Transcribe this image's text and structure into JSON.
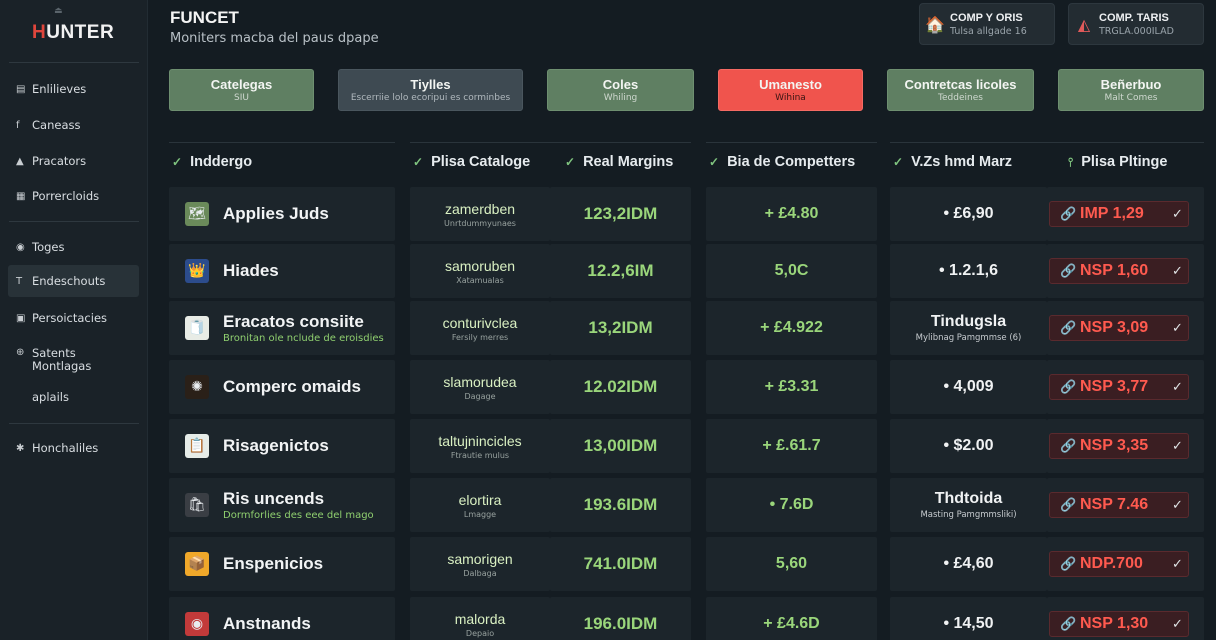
{
  "app": {
    "logo": "HUNTER",
    "title": "FUNCET",
    "subtitle": "Moniters macba del paus dpape"
  },
  "header_cards": [
    {
      "title": "COMP Y ORIS",
      "subtitle": "Tulsa allgade 16",
      "icon": "house-icon"
    },
    {
      "title": "COMP. TARIS",
      "subtitle": "TRGLA.000ILAD",
      "icon": "gauge-icon"
    }
  ],
  "sidebar": {
    "items": [
      {
        "label": "Enlilieves",
        "icon": "list-icon"
      },
      {
        "label": "Caneass",
        "icon": "facebook-icon"
      },
      {
        "label": "Pracators",
        "icon": "thumb-icon"
      },
      {
        "label": "Porrercloids",
        "icon": "grid-icon"
      },
      {
        "label": "Toges",
        "icon": "circle-icon"
      },
      {
        "label": "Endeschouts",
        "icon": "text-icon",
        "active": true
      },
      {
        "label": "Persoictacies",
        "icon": "clipboard-icon"
      },
      {
        "label": "Satents",
        "label2": "Montlagas",
        "icon": "globe-icon"
      },
      {
        "label": "aplails",
        "icon": ""
      },
      {
        "label": "Honchaliles",
        "icon": "gear-icon"
      }
    ]
  },
  "filters": [
    {
      "title": "Catelegas",
      "subtitle": "SIU",
      "style": "green"
    },
    {
      "title": "Tiylles",
      "subtitle": "Escerriie lolo ecoripui es corminbes",
      "style": "wide"
    },
    {
      "title": "Coles",
      "subtitle": "Whiling",
      "style": "green"
    },
    {
      "title": "Umanesto",
      "subtitle": "Wihina",
      "style": "red"
    },
    {
      "title": "Contretcas licoles",
      "subtitle": "Teddeines",
      "style": "green"
    },
    {
      "title": "Beñerbuo",
      "subtitle": "Malt Comes",
      "style": "green"
    }
  ],
  "table": {
    "columns": [
      {
        "label": "Inddergo",
        "marker": "check"
      },
      {
        "label": "Plisa Cataloge",
        "marker": "check"
      },
      {
        "label": "Real Margins",
        "marker": "check"
      },
      {
        "label": "Bia de Competters",
        "marker": "check"
      },
      {
        "label": "V.Zs hmd Marz",
        "marker": "check"
      },
      {
        "label": "Plisa Pltinge",
        "marker": "pin"
      }
    ],
    "rows": [
      {
        "product": "Applies Juds",
        "product_sub": "",
        "icon": "🗺",
        "icon_bg": "#6a8a5a",
        "catalog": "zamerdben",
        "catalog_sub": "Unrtdummyunaes",
        "margin": "123,2IDM",
        "competitor": "+ £4.80",
        "vz": "• £6,90",
        "vz_sub": "",
        "price": "IMP 1,29"
      },
      {
        "product": "Hiades",
        "product_sub": "",
        "icon": "👑",
        "icon_bg": "#2c4c8c",
        "catalog": "samoruben",
        "catalog_sub": "Xatamualas",
        "margin": "12.2,6IM",
        "competitor": "5,0C",
        "vz": "• 1.2.1,6",
        "vz_sub": "",
        "price": "NSP 1,60"
      },
      {
        "product": "Eracatos consiite",
        "product_sub": "Bronitan ole nclude de eroisdies",
        "icon": "🧻",
        "icon_bg": "#e8ece6",
        "catalog": "conturivclea",
        "catalog_sub": "Fersily merres",
        "margin": "13,2IDM",
        "competitor": "+ £4.922",
        "vz": "Tindugsla",
        "vz_sub": "Mylibnag Pamgmmse (6)",
        "price": "NSP 3,09"
      },
      {
        "product": "Comperc omaids",
        "product_sub": "",
        "icon": "✺",
        "icon_bg": "#2a2018",
        "catalog": "slamorudea",
        "catalog_sub": "Dagage",
        "margin": "12.02IDM",
        "competitor": "+ £3.31",
        "vz": "• 4,009",
        "vz_sub": "",
        "price": "NSP 3,77"
      },
      {
        "product": "Risagenictos",
        "product_sub": "",
        "icon": "📋",
        "icon_bg": "#e6ece8",
        "catalog": "taltujnincicles",
        "catalog_sub": "Ftrautie mulus",
        "margin": "13,00IDM",
        "competitor": "+ £.61.7",
        "vz": "• $2.00",
        "vz_sub": "",
        "price": "NSP 3,35"
      },
      {
        "product": "Ris uncends",
        "product_sub": "Dormforlies des eee del mago",
        "icon": "🛍",
        "icon_bg": "#3a3e44",
        "catalog": "elortira",
        "catalog_sub": "Lmagge",
        "margin": "193.6IDM",
        "competitor": "• 7.6D",
        "vz": "Thdtoida",
        "vz_sub": "Masting Pamgmmsliki)",
        "price": "NSP 7.46"
      },
      {
        "product": "Enspenicios",
        "product_sub": "",
        "icon": "📦",
        "icon_bg": "#f0a82a",
        "catalog": "samorigen",
        "catalog_sub": "Dalbaga",
        "margin": "741.0IDM",
        "competitor": "5,60",
        "vz": "• £4,60",
        "vz_sub": "",
        "price": "NDP.700"
      },
      {
        "product": "Anstnands",
        "product_sub": "",
        "icon": "◉",
        "icon_bg": "#c23a3a",
        "catalog": "malorda",
        "catalog_sub": "Depaio",
        "margin": "196.0IDM",
        "competitor": "+ £4.6D",
        "vz": "• 14,50",
        "vz_sub": "",
        "price": "NSP 1,30"
      }
    ]
  }
}
